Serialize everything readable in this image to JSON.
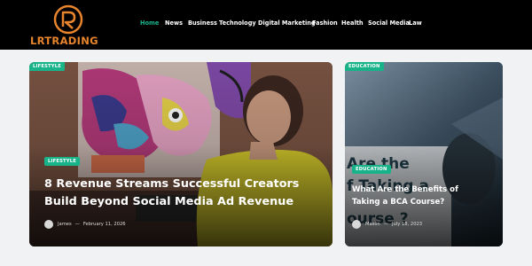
{
  "brand": {
    "name": "LRTRADING",
    "accent": "#e8842c"
  },
  "nav": {
    "active_color": "#19b38a",
    "items": [
      {
        "label": "Home",
        "active": true
      },
      {
        "label": "News"
      },
      {
        "label": "Business"
      },
      {
        "label": "Technology"
      },
      {
        "label": "Digital Marketing"
      },
      {
        "label": "Fashion"
      },
      {
        "label": "Health"
      },
      {
        "label": "Social Media"
      },
      {
        "label": "Law"
      }
    ]
  },
  "posts": [
    {
      "top_tag": "LIFESTYLE",
      "tag": "LIFESTYLE",
      "title_line1": "8 Revenue Streams Successful Creators",
      "title_line2": "Build Beyond Social Media Ad Revenue",
      "author": "James",
      "separator": "—",
      "date": "February 11, 2026"
    },
    {
      "top_tag": "EDUCATION",
      "tag": "EDUCATION",
      "title_line1": "What Are the Benefits of",
      "title_line2": "Taking a BCA Course?",
      "author": "Mason",
      "separator": "—",
      "date": "July 18, 2023"
    }
  ],
  "colors": {
    "tag_bg": "#19b38a",
    "header_bg": "#000000",
    "page_bg": "#f1f2f4"
  }
}
